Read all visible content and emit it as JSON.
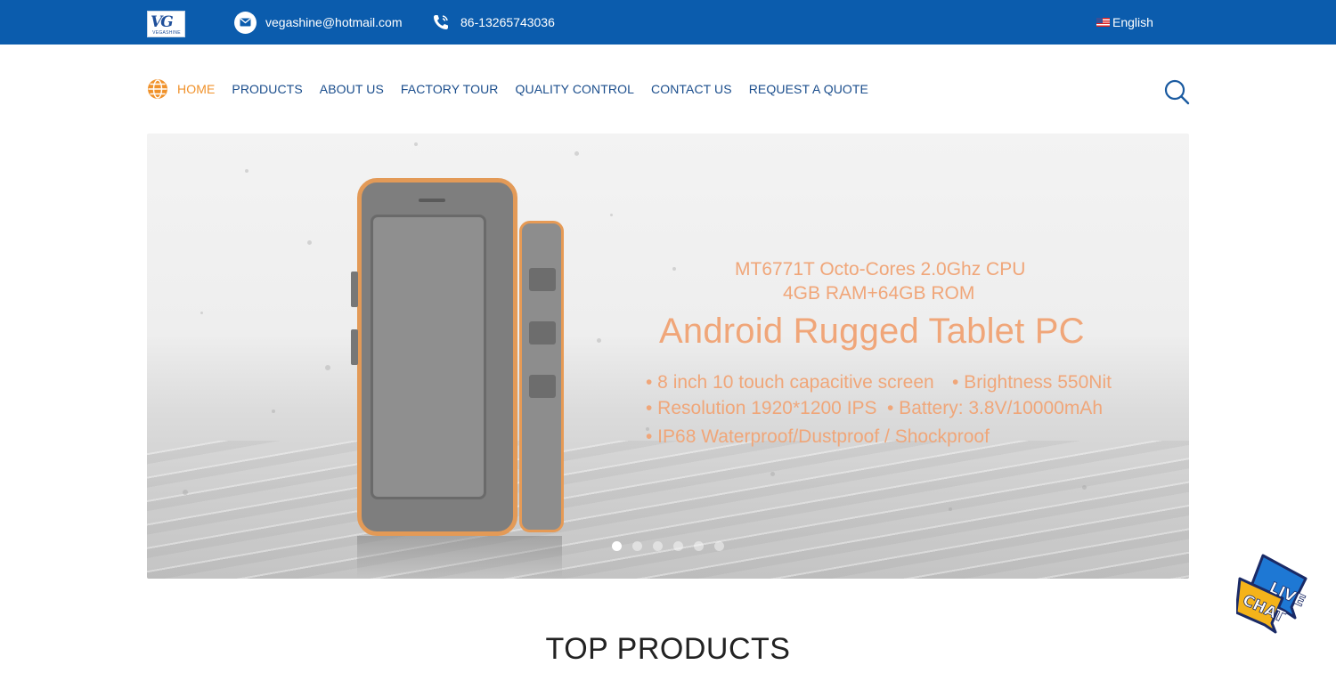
{
  "header": {
    "logo_text": "VG",
    "logo_sub": "VEGASHINE",
    "email": "vegashine@hotmail.com",
    "phone": "86-13265743036",
    "language": "English"
  },
  "nav": {
    "items": [
      "HOME",
      "PRODUCTS",
      "ABOUT US",
      "FACTORY TOUR",
      "QUALITY CONTROL",
      "CONTACT US",
      "REQUEST A QUOTE"
    ],
    "active_index": 0
  },
  "hero": {
    "spec_line_1": "MT6771T Octo-Cores 2.0Ghz CPU",
    "spec_line_2": "4GB RAM+64GB ROM",
    "headline": "Android Rugged Tablet PC",
    "bullets": [
      "• 8 inch 10 touch capacitive screen",
      "• Brightness 550Nit",
      "• Resolution 1920*1200 IPS",
      "• Battery: 3.8V/10000mAh",
      "• IP68 Waterproof/Dustproof / Shockproof"
    ],
    "slide_count": 6,
    "active_slide": 1,
    "text_color": "#f0a679"
  },
  "section": {
    "title": "TOP PRODUCTS"
  },
  "livechat": {
    "line1": "LIVE",
    "line2": "CHAT"
  },
  "colors": {
    "topbar": "#0b5cad",
    "nav_text": "#1a4d8c",
    "nav_active": "#f0922b"
  }
}
